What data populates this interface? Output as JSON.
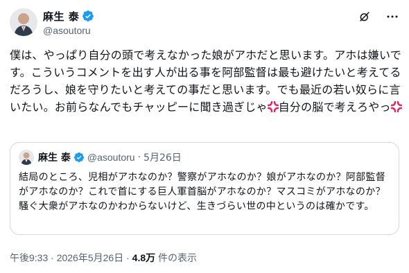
{
  "author": {
    "name": "麻生 泰",
    "handle": "@asoutoru"
  },
  "tweet": {
    "text_part1": "僕は、やっぱり自分の頭で考えなかった娘がアホだと思います。アホは嫌いです。こういうコメントを出す人が出る事を阿部監督は最も避けたいと考えてるだろうし、娘を守りたいと考えての事だと思います。でも最近の若い奴らに言いたい。お前らなんでもチャッピーに聞き過ぎじゃ",
    "text_part2": "自分の脳で考えろやっ"
  },
  "quote": {
    "name": "麻生 泰",
    "handle": "@asoutoru",
    "dot": "·",
    "date": "5月26日",
    "text": "結局のところ、児相がアホなのか？警察がアホなのか？娘がアホなのか？阿部監督がアホなのか？これで首にする巨人軍首脳がアホなのか？マスコミがアホなのか？騒ぐ大衆がアホなのかわからないけど、生きづらい世の中というのは確かです。"
  },
  "meta": {
    "time": "午後9:33",
    "sep1": " · ",
    "date": "2026年5月26日",
    "sep2": " · ",
    "views_count": "4.8万",
    "views_label": " 件の表示"
  },
  "icons": {
    "verified": "verified-badge-icon",
    "grok": "grok-icon",
    "more": "more-icon",
    "anger": "anger-symbol-icon"
  },
  "colors": {
    "verified_blue": "#1d9bf0",
    "secondary_text": "#536471",
    "border": "#cfd9de",
    "anger_red": "#e0245e"
  }
}
